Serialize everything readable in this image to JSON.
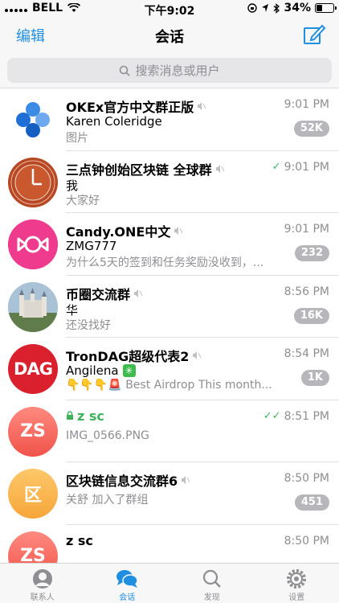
{
  "status_bar": {
    "carrier": "BELL",
    "time": "下午9:02",
    "battery": "34%",
    "battery_level": 0.34
  },
  "nav": {
    "edit_label": "编辑",
    "title": "会话",
    "compose_icon": "compose-icon"
  },
  "search": {
    "placeholder": "搜索消息或用户",
    "icon": "search-icon"
  },
  "chats": [
    {
      "name": "OKEx官方中文群正版",
      "sender": "Karen Coleridge",
      "preview": "图片",
      "time": "9:01 PM",
      "badge": "52K",
      "muted": true
    },
    {
      "name": "三点钟创始区块链 全球群",
      "sender": "我",
      "preview": "大家好",
      "time": "9:01 PM",
      "read_check": true,
      "muted": true
    },
    {
      "name": "Candy.ONE中文",
      "sender": "ZMG777",
      "preview": "为什么5天的签到和任务奖励没收到，...",
      "time": "9:01 PM",
      "badge": "232",
      "muted": true
    },
    {
      "name": "币圈交流群",
      "sender": "华",
      "preview": "还没找好",
      "time": "8:56 PM",
      "badge": "16K",
      "muted": true
    },
    {
      "name": "TronDAG超级代表2",
      "sender": "Angilena",
      "preview": "Best Airdrop This month...",
      "time": "8:54 PM",
      "badge": "1K",
      "muted": true,
      "avatar_text": "DAG"
    },
    {
      "name": "z sc",
      "preview": "IMG_0566.PNG",
      "time": "8:51 PM",
      "secret": true,
      "read_check": true,
      "avatar_text": "ZS"
    },
    {
      "name": "区块链信息交流群6",
      "sender": "关舒",
      "preview": "加入了群组",
      "time": "8:50 PM",
      "badge": "451",
      "muted": true,
      "avatar_text": "区"
    },
    {
      "name": "z sc",
      "time": "8:50 PM",
      "avatar_text": "ZS"
    }
  ],
  "tabs": [
    {
      "label": "联系人",
      "icon": "contacts-icon"
    },
    {
      "label": "会话",
      "icon": "chats-icon",
      "active": true
    },
    {
      "label": "发现",
      "icon": "discover-icon"
    },
    {
      "label": "设置",
      "icon": "settings-icon"
    }
  ],
  "colors": {
    "accent": "#1e8fe1",
    "badge": "#b6b6bb",
    "check": "#3fb35c"
  }
}
